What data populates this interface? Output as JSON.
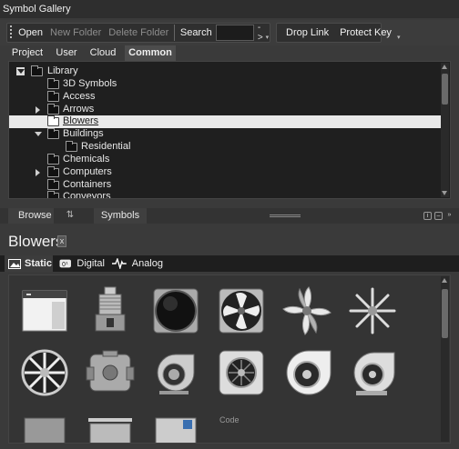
{
  "window": {
    "title": "Symbol Gallery"
  },
  "toolbar": {
    "open": "Open",
    "new_folder": "New Folder",
    "delete_folder": "Delete Folder",
    "search_label": "Search",
    "search_value": "",
    "go": "->",
    "drop_link": "Drop Link",
    "protect_key": "Protect Key"
  },
  "tabs": [
    "Project",
    "User",
    "Cloud",
    "Common"
  ],
  "active_tab": "Common",
  "tree": [
    {
      "label": "Library",
      "expanded": true
    },
    {
      "label": "3D Symbols"
    },
    {
      "label": "Access"
    },
    {
      "label": "Arrows",
      "expandable": true
    },
    {
      "label": "Blowers",
      "selected": true
    },
    {
      "label": "Buildings",
      "expanded": true
    },
    {
      "label": "Residential"
    },
    {
      "label": "Chemicals"
    },
    {
      "label": "Computers",
      "expandable": true
    },
    {
      "label": "Containers"
    },
    {
      "label": "Conveyors"
    }
  ],
  "panel": {
    "browse": "Browse",
    "symbols": "Symbols"
  },
  "gallery": {
    "title": "Blowers",
    "close": "x",
    "subtabs": [
      "Static",
      "Digital",
      "Analog"
    ],
    "active_subtab": "Static",
    "partial_label": "Code"
  },
  "colors": {
    "selection_bg": "#e9e9e9",
    "dark_bg": "#1f1f1f",
    "chrome": "#3a3a3a"
  },
  "icons": [
    "expand-icon",
    "folder-icon",
    "image-icon",
    "digital-icon",
    "analog-wave-icon",
    "blower-symbol"
  ]
}
